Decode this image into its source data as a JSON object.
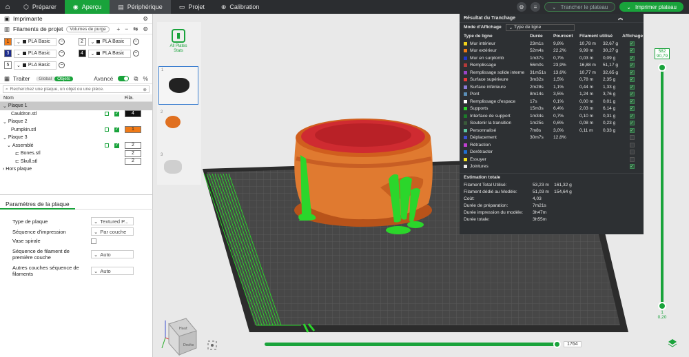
{
  "topbar": {
    "tabs": [
      {
        "label": "Préparer",
        "icon": "cube-icon"
      },
      {
        "label": "Aperçu",
        "icon": "eye-icon"
      },
      {
        "label": "Périphérique",
        "icon": "printer-icon"
      },
      {
        "label": "Projet",
        "icon": "folder-icon"
      },
      {
        "label": "Calibration",
        "icon": "target-icon"
      }
    ],
    "slice_button": "Trancher le plateau",
    "print_button": "Imprimer plateau"
  },
  "left": {
    "printer": {
      "title": "Imprimante"
    },
    "filaments": {
      "title": "Filaments de projet",
      "purge_pill": "Volumes de purge",
      "items": [
        {
          "num": "1",
          "color": "#f07a17",
          "label": "PLA Basic",
          "text_color": "#222"
        },
        {
          "num": "2",
          "color": "#ffffff",
          "label": "PLA Basic",
          "text_color": "#222"
        },
        {
          "num": "3",
          "color": "#1b2a8c",
          "label": "PLA Basic",
          "text_color": "#fff"
        },
        {
          "num": "4",
          "color": "#111111",
          "label": "PLA Basic",
          "text_color": "#fff"
        },
        {
          "num": "5",
          "color": "#ffffff",
          "label": "PLA Basic",
          "text_color": "#222"
        }
      ]
    },
    "process": {
      "title": "Traiter",
      "seg_global": "Global",
      "seg_objects": "Objets",
      "advanced": "Avancé"
    },
    "search_placeholder": "Recherchez une plaque, un objet ou une pièce.",
    "obj_header": {
      "name": "Nom",
      "fila": "Fila."
    },
    "objects": {
      "p1": "Plaque 1",
      "p1_item": "Cauldron.stl",
      "p1_fil": "4",
      "p2": "Plaque 2",
      "p2_item": "Pumpkin.stl",
      "p2_fil": "1",
      "p3": "Plaque 3",
      "p3_group": "Assemblé",
      "p3_group_fil": "2",
      "p3_a": "Bones.stl",
      "p3_a_fil": "2",
      "p3_b": "Skull.stl",
      "p3_b_fil": "2",
      "hors": "Hors plaque"
    },
    "params": {
      "title": "Paramètres de la plaque",
      "rows": [
        {
          "label": "Type de plaque",
          "value": "Textured P..."
        },
        {
          "label": "Séquence d'impression",
          "value": "Par couche"
        },
        {
          "label": "Vase spirale",
          "value": ""
        },
        {
          "label": "Séquence de filament de première couche",
          "value": "Auto"
        },
        {
          "label": "Autres couches séquence de filaments",
          "value": "Auto"
        }
      ]
    }
  },
  "thumbs": {
    "all_plates": "All Plates Stats",
    "t1": "1",
    "t2": "2",
    "t3": "3"
  },
  "stats": {
    "title": "Résultat du Tranchage",
    "mode_label": "Mode d'Affichage",
    "mode_value": "Type de ligne",
    "headers": [
      "Type de ligne",
      "Durée",
      "Pourcent",
      "Filament utilisé",
      "Affichage"
    ],
    "rows": [
      {
        "name": "Mur intérieur",
        "color": "#f2d21a",
        "time": "23m1s",
        "pct": "9,8%",
        "m": "10,78 m",
        "g": "32,67 g",
        "show": true
      },
      {
        "name": "Mur extérieur",
        "color": "#f07a17",
        "time": "52m4s",
        "pct": "22,2%",
        "m": "9,99 m",
        "g": "30,27 g",
        "show": true
      },
      {
        "name": "Mur en surplomb",
        "color": "#2338c9",
        "time": "1m37s",
        "pct": "0,7%",
        "m": "0,03 m",
        "g": "0,09 g",
        "show": true
      },
      {
        "name": "Remplissage",
        "color": "#b33a3a",
        "time": "56m0s",
        "pct": "23,9%",
        "m": "16,88 m",
        "g": "51,17 g",
        "show": true
      },
      {
        "name": "Remplissage solide interne",
        "color": "#9a45c8",
        "time": "31m51s",
        "pct": "13,6%",
        "m": "10,77 m",
        "g": "32,65 g",
        "show": true
      },
      {
        "name": "Surface supérieure",
        "color": "#e83a3a",
        "time": "3m32s",
        "pct": "1,5%",
        "m": "0,78 m",
        "g": "2,35 g",
        "show": true
      },
      {
        "name": "Surface inférieure",
        "color": "#8a7bd8",
        "time": "2m28s",
        "pct": "1,1%",
        "m": "0,44 m",
        "g": "1,33 g",
        "show": true
      },
      {
        "name": "Pont",
        "color": "#5b8fb8",
        "time": "8m14s",
        "pct": "3,5%",
        "m": "1,24 m",
        "g": "3,76 g",
        "show": true
      },
      {
        "name": "Remplissage d'espace",
        "color": "#ffffff",
        "time": "17s",
        "pct": "0,1%",
        "m": "0,00 m",
        "g": "0,01 g",
        "show": true
      },
      {
        "name": "Supports",
        "color": "#2bd62b",
        "time": "15m3s",
        "pct": "6,4%",
        "m": "2,03 m",
        "g": "6,14 g",
        "show": true
      },
      {
        "name": "Interface de support",
        "color": "#1d7a2a",
        "time": "1m34s",
        "pct": "0,7%",
        "m": "0,10 m",
        "g": "0,31 g",
        "show": true
      },
      {
        "name": "Soutenir la transition",
        "color": "#3a5a3a",
        "time": "1m25s",
        "pct": "0,6%",
        "m": "0,08 m",
        "g": "0,23 g",
        "show": true
      },
      {
        "name": "Personnalisé",
        "color": "#5ec6a0",
        "time": "7m8s",
        "pct": "3,0%",
        "m": "0,11 m",
        "g": "0,33 g",
        "show": true
      },
      {
        "name": "Déplacement",
        "color": "#3b4fd0",
        "time": "30m7s",
        "pct": "12,8%",
        "m": "",
        "g": "",
        "show": false
      },
      {
        "name": "Rétraction",
        "color": "#c040d0",
        "time": "",
        "pct": "",
        "m": "",
        "g": "",
        "show": false
      },
      {
        "name": "Derétracter",
        "color": "#1f6fd0",
        "time": "",
        "pct": "",
        "m": "",
        "g": "",
        "show": false
      },
      {
        "name": "Essuyer",
        "color": "#f0e020",
        "time": "",
        "pct": "",
        "m": "",
        "g": "",
        "show": false
      },
      {
        "name": "Jointures",
        "color": "#e8e8e8",
        "time": "",
        "pct": "",
        "m": "",
        "g": "",
        "show": true
      }
    ],
    "estimate_title": "Estimation totale",
    "estimates": [
      {
        "k": "Filament Total Utilisé:",
        "v": "53,23 m    161,32 g"
      },
      {
        "k": "Filament dédié au Modèle:",
        "v": "51,03 m    154,64 g"
      },
      {
        "k": "Coût:",
        "v": "4,03"
      },
      {
        "k": "Durée de préparation:",
        "v": "7m21s"
      },
      {
        "k": "Durée impression du modèle:",
        "v": "3h47m"
      },
      {
        "k": "Durée totale:",
        "v": "3h55m"
      }
    ]
  },
  "vslider": {
    "top_value": "582",
    "top_height": "90,79",
    "bottom_value": "1",
    "bottom_height": "0,20"
  },
  "hslider": {
    "value": "1764"
  },
  "cube": {
    "face1": "Haut",
    "face2": "Droite"
  }
}
